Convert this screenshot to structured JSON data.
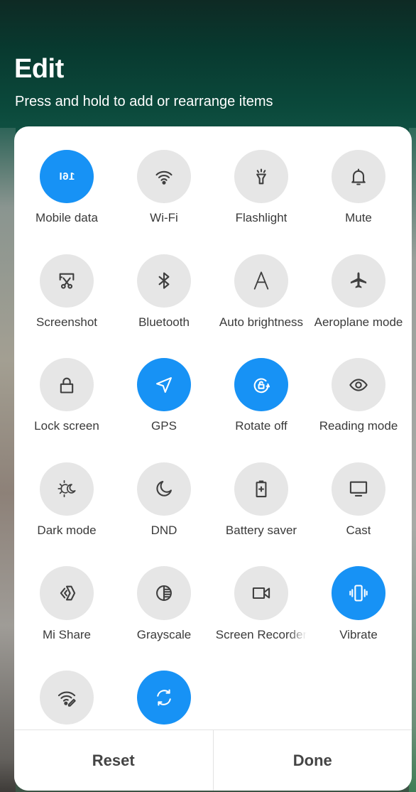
{
  "header": {
    "title": "Edit",
    "subtitle": "Press and hold to add or rearrange items"
  },
  "tiles": [
    {
      "label": "Mobile data",
      "icon": "mobile-data-icon",
      "active": true,
      "glyph": "16I"
    },
    {
      "label": "Wi-Fi",
      "icon": "wifi-icon",
      "active": false
    },
    {
      "label": "Flashlight",
      "icon": "flashlight-icon",
      "active": false
    },
    {
      "label": "Mute",
      "icon": "bell-icon",
      "active": false
    },
    {
      "label": "Screenshot",
      "icon": "screenshot-scissors-icon",
      "active": false
    },
    {
      "label": "Bluetooth",
      "icon": "bluetooth-icon",
      "active": false
    },
    {
      "label": "Auto brightness",
      "icon": "auto-brightness-icon",
      "active": false
    },
    {
      "label": "Aeroplane mode",
      "icon": "airplane-icon",
      "active": false
    },
    {
      "label": "Lock screen",
      "icon": "lock-icon",
      "active": false
    },
    {
      "label": "GPS",
      "icon": "location-arrow-icon",
      "active": true
    },
    {
      "label": "Rotate off",
      "icon": "rotation-lock-icon",
      "active": true
    },
    {
      "label": "Reading mode",
      "icon": "eye-icon",
      "active": false
    },
    {
      "label": "Dark mode",
      "icon": "dark-mode-icon",
      "active": false
    },
    {
      "label": "DND",
      "icon": "moon-icon",
      "active": false
    },
    {
      "label": "Battery saver",
      "icon": "battery-saver-icon",
      "active": false
    },
    {
      "label": "Cast",
      "icon": "monitor-icon",
      "active": false
    },
    {
      "label": "Mi Share",
      "icon": "mi-share-icon",
      "active": false
    },
    {
      "label": "Grayscale",
      "icon": "grayscale-icon",
      "active": false
    },
    {
      "label": "Screen Recorder",
      "icon": "video-camera-icon",
      "active": false,
      "truncated": true
    },
    {
      "label": "Vibrate",
      "icon": "vibrate-icon",
      "active": true
    },
    {
      "label": "",
      "icon": "wifi-edit-icon",
      "active": false
    },
    {
      "label": "",
      "icon": "sync-icon",
      "active": true
    }
  ],
  "footer": {
    "reset_label": "Reset",
    "done_label": "Done"
  },
  "colors": {
    "active": "#1792f5",
    "inactive": "#e6e6e6",
    "icon": "#3f3f3f"
  }
}
